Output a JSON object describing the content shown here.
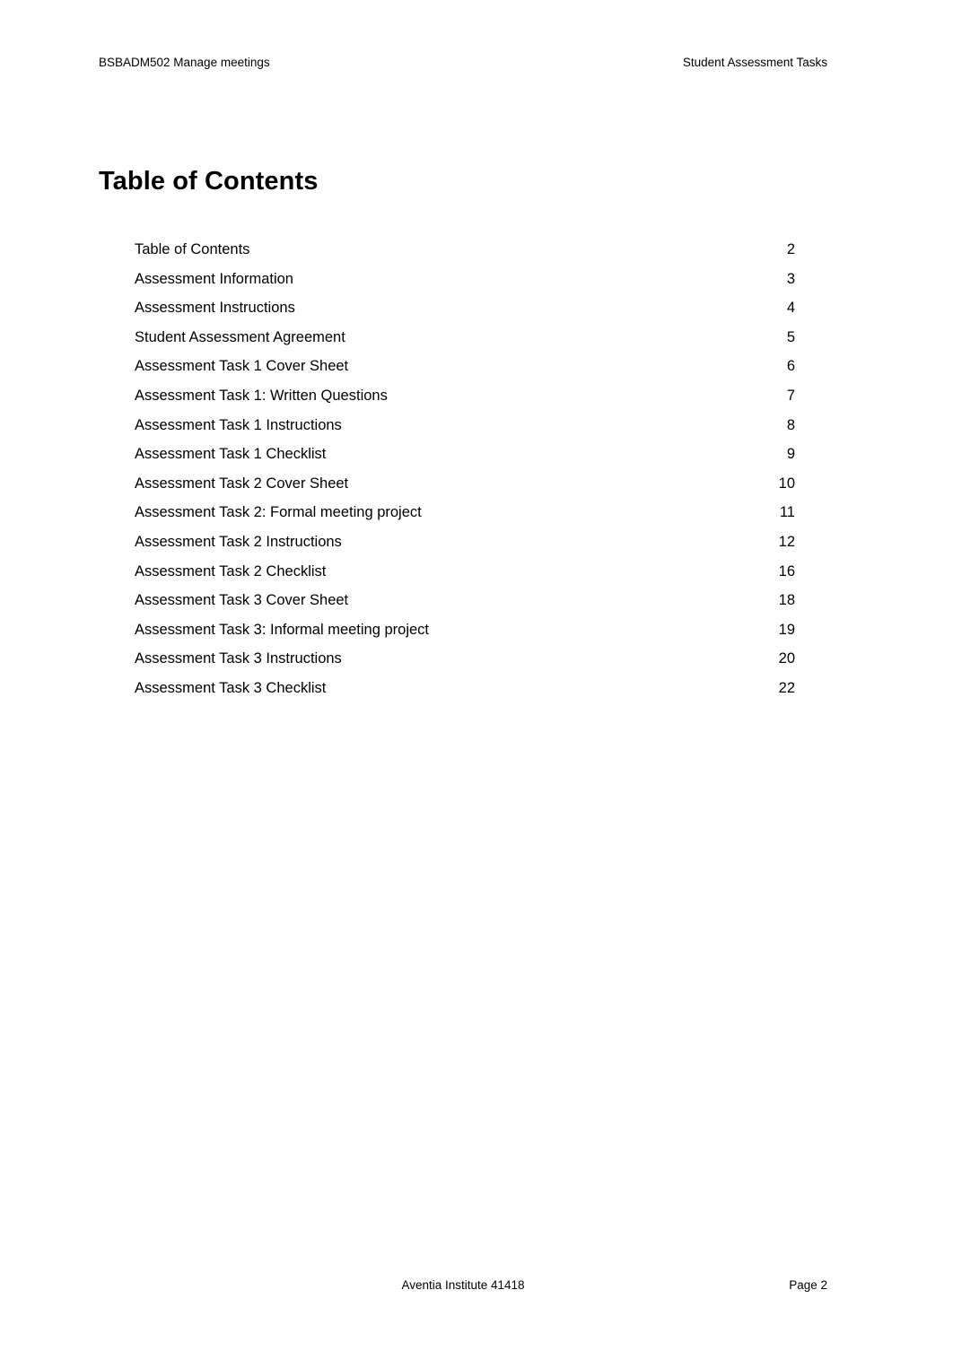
{
  "header": {
    "left": "BSBADM502 Manage meetings",
    "right": "Student Assessment Tasks"
  },
  "title": "Table of Contents",
  "toc": {
    "entries": [
      {
        "title": "Table of Contents",
        "page": "2"
      },
      {
        "title": "Assessment Information",
        "page": "3"
      },
      {
        "title": "Assessment Instructions",
        "page": "4"
      },
      {
        "title": "Student Assessment Agreement",
        "page": "5"
      },
      {
        "title": "Assessment Task 1 Cover Sheet",
        "page": "6"
      },
      {
        "title": "Assessment Task 1: Written Questions",
        "page": "7"
      },
      {
        "title": "Assessment Task 1 Instructions",
        "page": "8"
      },
      {
        "title": "Assessment Task 1 Checklist",
        "page": "9"
      },
      {
        "title": "Assessment Task 2 Cover Sheet",
        "page": "10"
      },
      {
        "title": "Assessment Task 2: Formal meeting project",
        "page": "11"
      },
      {
        "title": "Assessment Task 2 Instructions",
        "page": "12"
      },
      {
        "title": "Assessment Task 2 Checklist",
        "page": "16"
      },
      {
        "title": "Assessment Task 3 Cover Sheet",
        "page": "18"
      },
      {
        "title": "Assessment Task 3: Informal meeting project",
        "page": "19"
      },
      {
        "title": "Assessment Task 3 Instructions",
        "page": "20"
      },
      {
        "title": "Assessment Task 3 Checklist",
        "page": "22"
      }
    ]
  },
  "footer": {
    "center": "Aventia Institute 41418",
    "right": "Page 2"
  }
}
